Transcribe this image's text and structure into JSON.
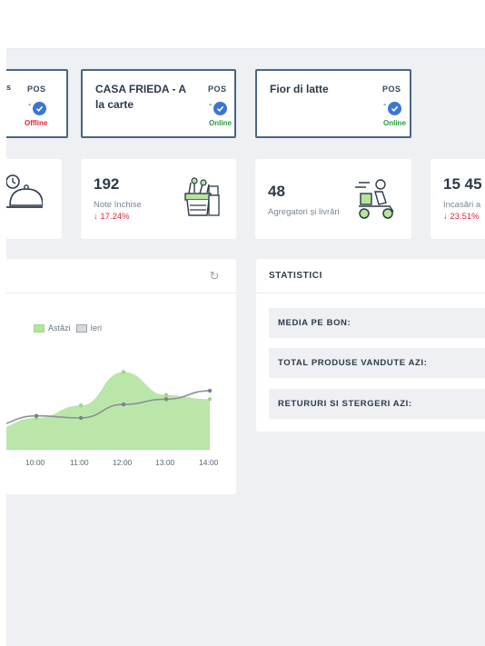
{
  "pos_cards": [
    {
      "name": "",
      "label": "POS",
      "dash": "-",
      "status": "Offline"
    },
    {
      "name": "CASA FRIEDA - A la carte",
      "label": "POS",
      "dash": "-",
      "status": "Online"
    },
    {
      "name": "Fior di latte",
      "label": "POS",
      "dash": "-",
      "status": "Online"
    }
  ],
  "stats": {
    "closed_notes": {
      "value": "192",
      "label": "Note închise",
      "change": "17.24%"
    },
    "aggregators": {
      "value": "48",
      "label": "Agregatori și livrări"
    },
    "revenue": {
      "value": "15 45",
      "label": "Incasări a",
      "change": "23.51%"
    }
  },
  "chart_panel": {
    "refresh_icon": "refresh-icon"
  },
  "chart_data": {
    "type": "area",
    "x": [
      "10:00",
      "11:00",
      "12:00",
      "13:00",
      "14:00"
    ],
    "series": [
      {
        "name": "Astăzi",
        "color": "#aee29b",
        "values": [
          20,
          32,
          64,
          42,
          38
        ]
      },
      {
        "name": "Ieri",
        "color": "#8d9196",
        "values": [
          22,
          20,
          33,
          38,
          46
        ]
      }
    ],
    "legend": [
      "Astăzi",
      "Ieri"
    ],
    "legend_position": "top-right"
  },
  "statistics": {
    "title": "STATISTICI",
    "rows": [
      "MEDIA PE BON:",
      "TOTAL PRODUSE VANDUTE AZI:",
      "RETURURI SI STERGERI AZI:"
    ]
  }
}
